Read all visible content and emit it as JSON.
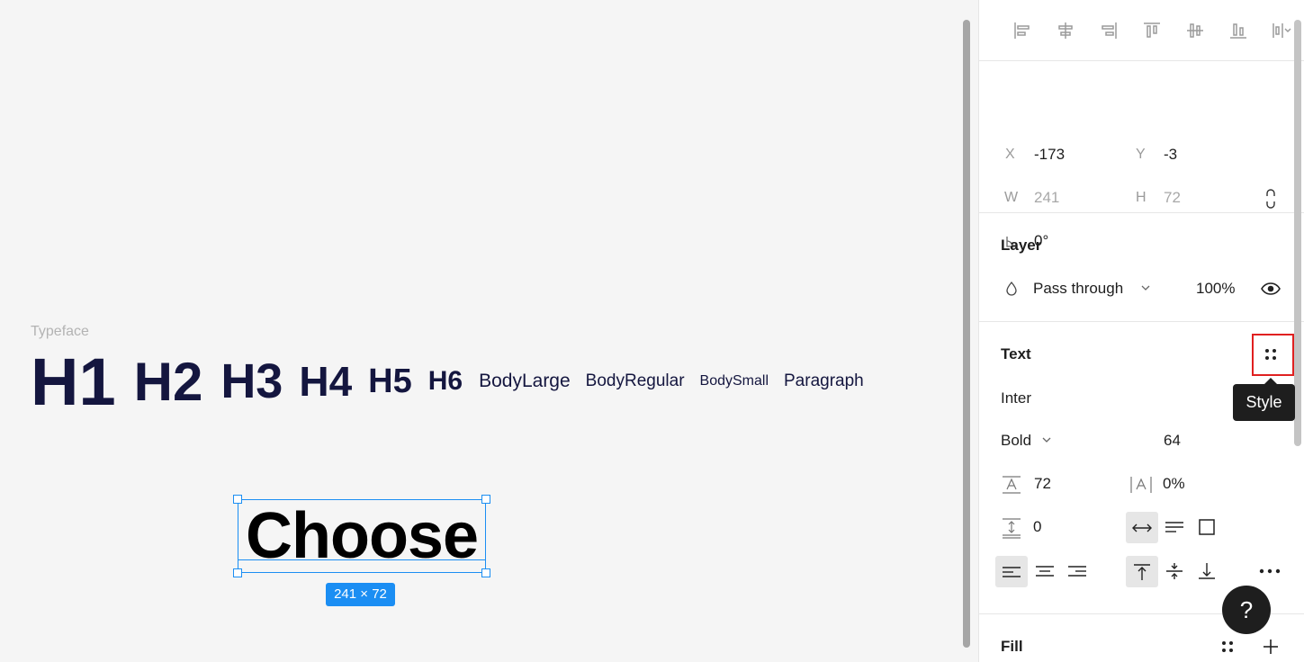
{
  "canvas": {
    "typeface_label": "Typeface",
    "styles": [
      "H1",
      "H2",
      "H3",
      "H4",
      "H5",
      "H6",
      "BodyLarge",
      "BodyRegular",
      "BodySmall",
      "Paragraph"
    ],
    "selected_text": "Choose",
    "size_badge": "241 × 72"
  },
  "panel": {
    "alignment": [
      "align-left-icon",
      "align-horizontal-center-icon",
      "align-right-icon",
      "align-top-icon",
      "align-vertical-center-icon",
      "align-bottom-icon",
      "distribute-icon"
    ],
    "position": {
      "x_label": "X",
      "x": "-173",
      "y_label": "Y",
      "y": "-3",
      "w_label": "W",
      "w": "241",
      "h_label": "H",
      "h": "72",
      "rotation": "0°"
    },
    "layer": {
      "title": "Layer",
      "blend_mode": "Pass through",
      "opacity": "100%"
    },
    "text": {
      "title": "Text",
      "font_family": "Inter",
      "font_weight": "Bold",
      "font_size": "64",
      "line_height": "72",
      "letter_spacing": "0%",
      "paragraph_spacing": "0"
    },
    "tooltip": "Style",
    "fill": {
      "title": "Fill"
    },
    "help": "?"
  },
  "colors": {
    "selection": "#1b8ef3",
    "type_color": "#14163f",
    "highlight": "#e02020"
  }
}
